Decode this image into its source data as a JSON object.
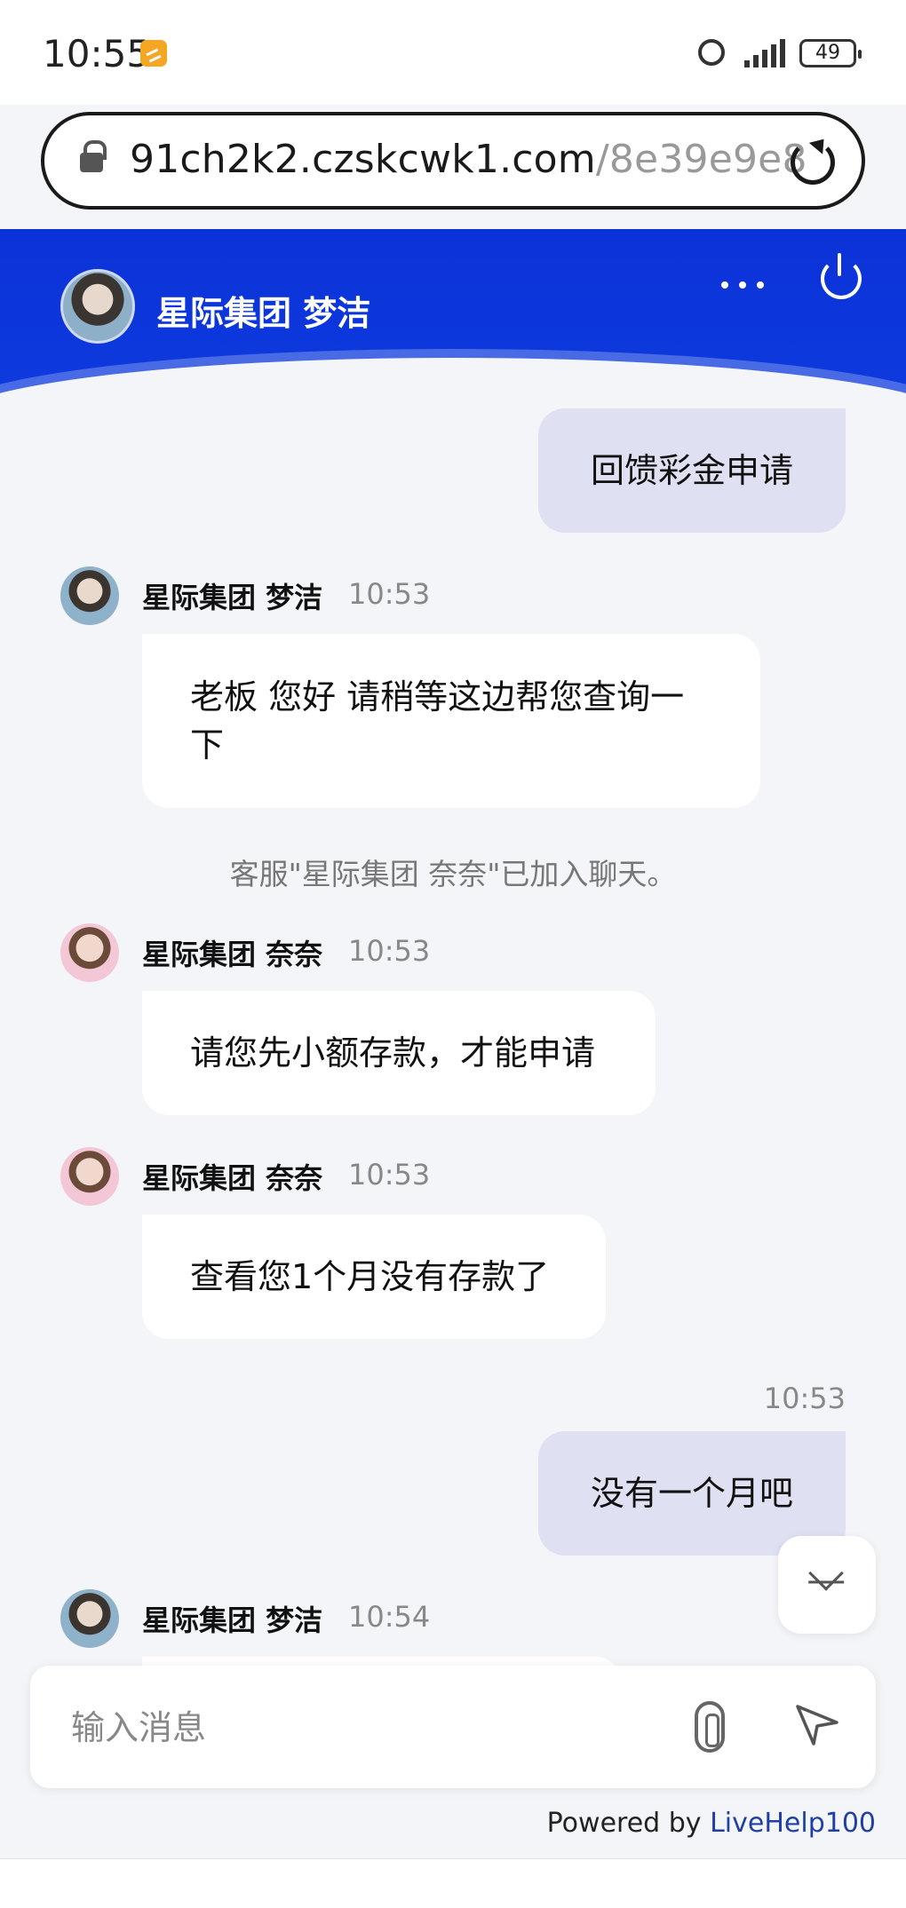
{
  "status_bar": {
    "time": "10:55",
    "battery": "49"
  },
  "browser": {
    "url_host": "91ch2k2.czskcwk1.com",
    "url_path": "/8e39e9e8"
  },
  "header": {
    "agent_name": "星际集团 梦洁"
  },
  "messages": {
    "m1_text": "回馈彩金申请",
    "m2_name": "星际集团 梦洁",
    "m2_time": "10:53",
    "m2_text": "老板 您好 请稍等这边帮您查询一下",
    "system_text": "客服\"星际集团 奈奈\"已加入聊天。",
    "m3_name": "星际集团 奈奈",
    "m3_time": "10:53",
    "m3_text": "请您先小额存款，才能申请",
    "m4_name": "星际集团 奈奈",
    "m4_time": "10:53",
    "m4_text": "查看您1个月没有存款了",
    "m5_time": "10:53",
    "m5_text": "没有一个月吧",
    "m6_name": "星际集团 梦洁",
    "m6_time": "10:54"
  },
  "input": {
    "placeholder": "输入消息"
  },
  "footer": {
    "powered_prefix": "Powered by ",
    "powered_brand": "LiveHelp100"
  },
  "colors": {
    "header_blue": "#0b32d8",
    "outgoing_bubble": "#dfe1f2",
    "link_blue": "#1f3fa8"
  },
  "icons": [
    "notification-icon",
    "alarm-icon",
    "signal-icon",
    "battery-icon",
    "lock-icon",
    "reload-icon",
    "more-icon",
    "power-icon",
    "chevron-down-icon",
    "paperclip-icon",
    "send-icon"
  ]
}
